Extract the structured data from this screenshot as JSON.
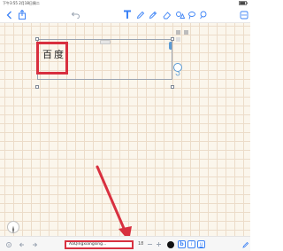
{
  "statusbar": {
    "time": "下午3:55  2月18日周二"
  },
  "canvas": {
    "entered_text": "百度"
  },
  "bottombar": {
    "font_name": "AaQingxiangsing...",
    "font_size": "18",
    "format_buttons": {
      "bold": "b",
      "italic": "i",
      "underline": "u"
    }
  },
  "colors": {
    "accent": "#3b82f6",
    "highlight": "#d8303f",
    "paper": "#fbf6ec",
    "grid": "#ecdcc9"
  }
}
